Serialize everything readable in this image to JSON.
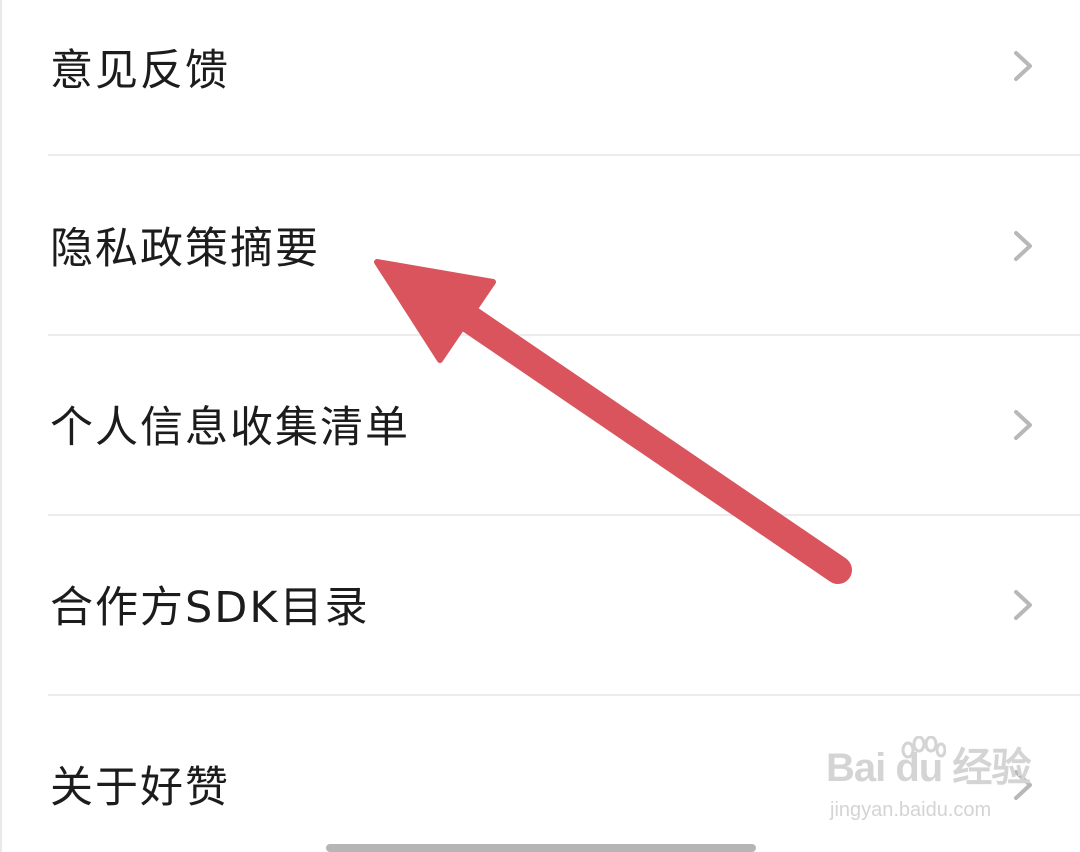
{
  "menu": {
    "items": [
      {
        "label": "意见反馈",
        "icon": "chevron-right-icon"
      },
      {
        "label": "隐私政策摘要",
        "icon": "chevron-right-icon"
      },
      {
        "label": "个人信息收集清单",
        "icon": "chevron-right-icon"
      },
      {
        "label": "合作方SDK目录",
        "icon": "chevron-right-icon"
      },
      {
        "label": "关于好赞",
        "icon": "chevron-right-icon"
      }
    ]
  },
  "annotation": {
    "arrow_color": "#d9545c",
    "points_to": "隐私政策摘要"
  },
  "watermark": {
    "logo_text": "Bai du 经验",
    "url": "jingyan.baidu.com"
  },
  "colors": {
    "background": "#ffffff",
    "text": "#1c1c1c",
    "chevron": "#b8b8b8",
    "divider": "#ececec"
  }
}
